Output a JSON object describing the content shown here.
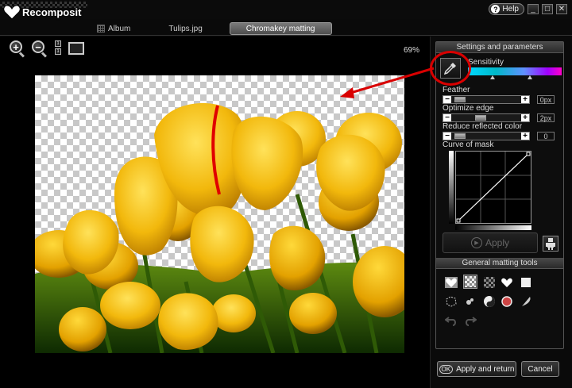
{
  "app": {
    "name": "Recomposit"
  },
  "window_controls": {
    "help_label": "Help",
    "minimize": "_",
    "maximize": "□",
    "close": "✕"
  },
  "tabs": [
    {
      "label": "Album"
    },
    {
      "label": "Tulips.jpg"
    },
    {
      "label": "Chromakey matting",
      "active": true
    }
  ],
  "toolbar": {
    "zoom_level": "69%",
    "ratio_top": "1",
    "ratio_bottom": "1"
  },
  "settings": {
    "header": "Settings and parameters",
    "sensitivity": {
      "label": "Sensitivity"
    },
    "feather": {
      "label": "Feather",
      "value": "0px",
      "level": 0.05
    },
    "optimize_edge": {
      "label": "Optimize edge",
      "value": "2px",
      "level": 0.4
    },
    "reduce_reflected_color": {
      "label": "Reduce reflected color",
      "value": "0",
      "level": 0.05
    },
    "curve_label": "Curve of mask",
    "apply_label": "Apply"
  },
  "general_tools": {
    "header": "General matting tools"
  },
  "bottom": {
    "apply_return_label": "Apply and return",
    "ok_badge": "OK",
    "cancel_label": "Cancel"
  },
  "colors": {
    "accent_red": "#d90000",
    "panel_border": "#555555",
    "sensitivity_start": "#00d8ff",
    "sensitivity_end": "#ff00c8"
  }
}
